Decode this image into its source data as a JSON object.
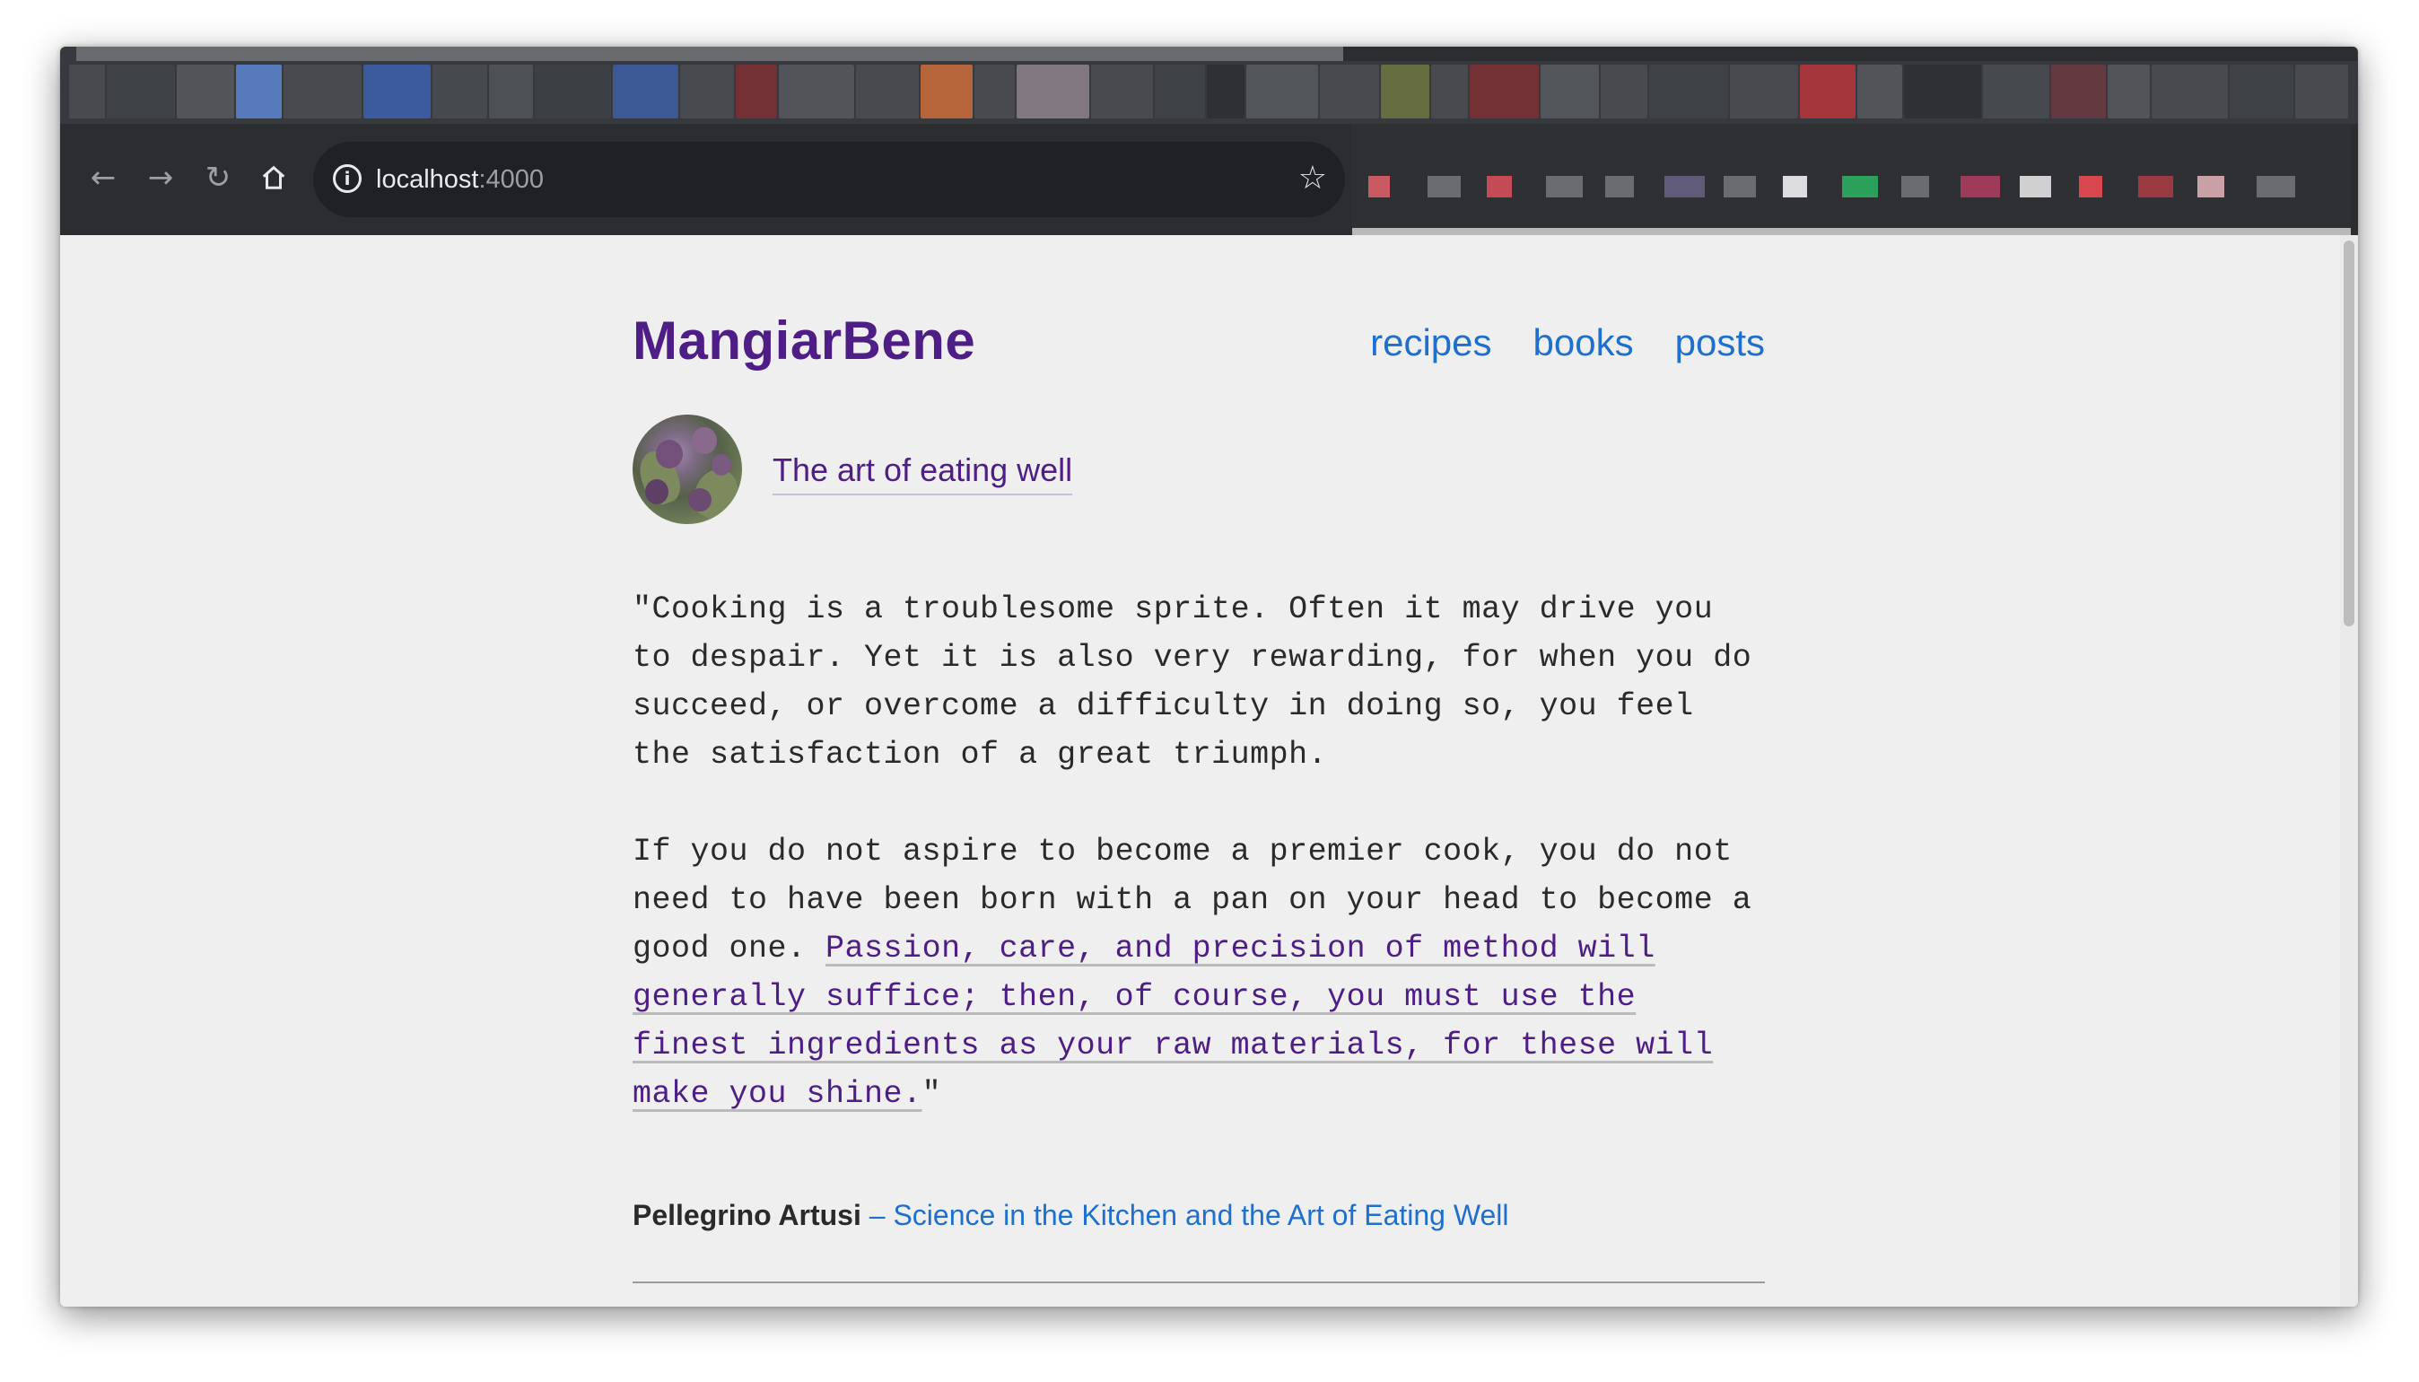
{
  "browser": {
    "back_icon": "arrow-left-icon",
    "forward_icon": "arrow-right-icon",
    "reload_icon": "reload-icon",
    "home_icon": "home-icon",
    "info_icon": "info-icon",
    "bookmark_icon": "star-icon",
    "url_host": "localhost",
    "url_port": ":4000"
  },
  "site": {
    "title": "MangiarBene",
    "nav": [
      {
        "label": "recipes"
      },
      {
        "label": "books"
      },
      {
        "label": "posts"
      }
    ],
    "tagline": "The art of eating well"
  },
  "quote": {
    "para1": "\"Cooking is a troublesome sprite. Often it may drive you to despair. Yet it is also very rewarding, for when you do succeed, or overcome a difficulty in doing so, you feel the satisfaction of a great triumph.",
    "para2_plain": "If you do not aspire to become a premier cook, you do not need to have been born with a pan on your head to become a good one. ",
    "para2_link": "Passion, care, and precision of method will generally suffice; then, of course, you must use the finest ingredients as your raw materials, for these will make you shine.",
    "para2_end": "\""
  },
  "attribution": {
    "author": "Pellegrino Artusi",
    "book": " – Science in the Kitchen and the Art of Eating Well"
  }
}
